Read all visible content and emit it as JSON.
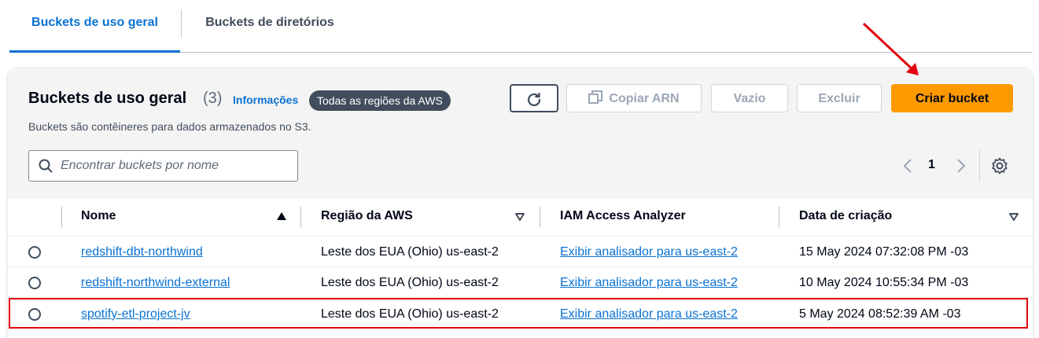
{
  "tabs": [
    {
      "label": "Buckets de uso geral"
    },
    {
      "label": "Buckets de diretórios"
    }
  ],
  "header": {
    "title": "Buckets de uso geral",
    "count": "(3)",
    "info_link": "Informações",
    "region_badge": "Todas as regiões da AWS",
    "description": "Buckets são contêineres para dados armazenados no S3."
  },
  "actions": {
    "refresh_icon": "refresh-icon",
    "copy_arn": "Copiar ARN",
    "empty": "Vazio",
    "delete": "Excluir",
    "create": "Criar bucket"
  },
  "search": {
    "placeholder": "Encontrar buckets por nome",
    "value": ""
  },
  "pagination": {
    "current_page": "1"
  },
  "table": {
    "columns": [
      "Nome",
      "Região da AWS",
      "IAM Access Analyzer",
      "Data de criação"
    ],
    "rows": [
      {
        "name": "redshift-dbt-northwind",
        "region": "Leste dos EUA (Ohio) us-east-2",
        "analyzer": "Exibir analisador para us-east-2",
        "created": "15 May 2024 07:32:08 PM -03"
      },
      {
        "name": "redshift-northwind-external",
        "region": "Leste dos EUA (Ohio) us-east-2",
        "analyzer": "Exibir analisador para us-east-2",
        "created": "10 May 2024 10:55:34 PM -03"
      },
      {
        "name": "spotify-etl-project-jv",
        "region": "Leste dos EUA (Ohio) us-east-2",
        "analyzer": "Exibir analisador para us-east-2",
        "created": "5 May 2024 08:52:39 AM -03"
      }
    ]
  },
  "colors": {
    "accent_link": "#0972d3",
    "primary_button": "#ff9900",
    "annotation_red": "#e3000f"
  }
}
